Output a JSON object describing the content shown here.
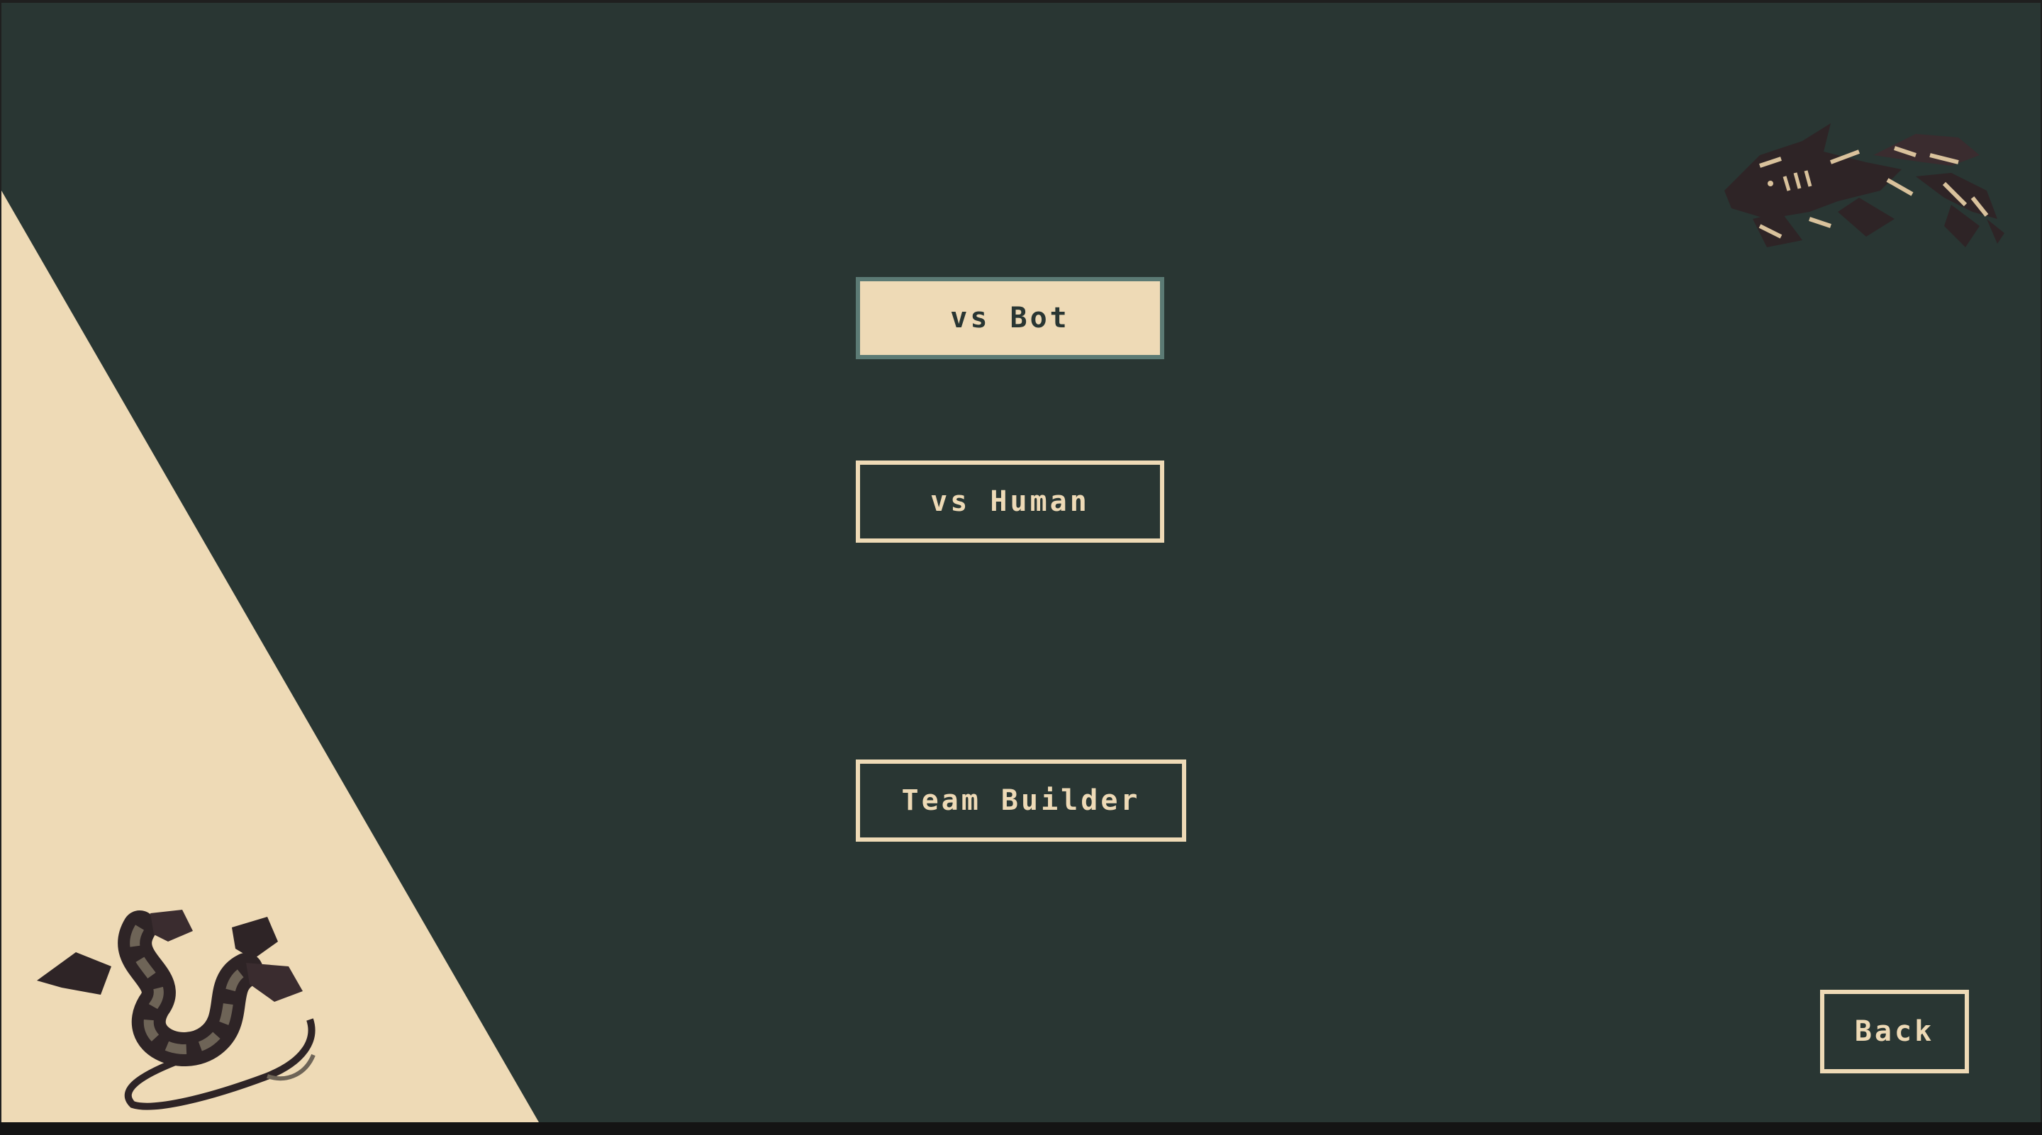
{
  "menu": {
    "vs_bot_label": "vs Bot",
    "vs_human_label": "vs Human",
    "team_builder_label": "Team Builder",
    "back_label": "Back"
  },
  "colors": {
    "background": "#293633",
    "accent_cream": "#eedab6",
    "selected_border": "#5b7a74",
    "sprite_dark": "#2e2426"
  },
  "sprites": [
    "shark-creature-icon",
    "serpent-creature-icon"
  ]
}
